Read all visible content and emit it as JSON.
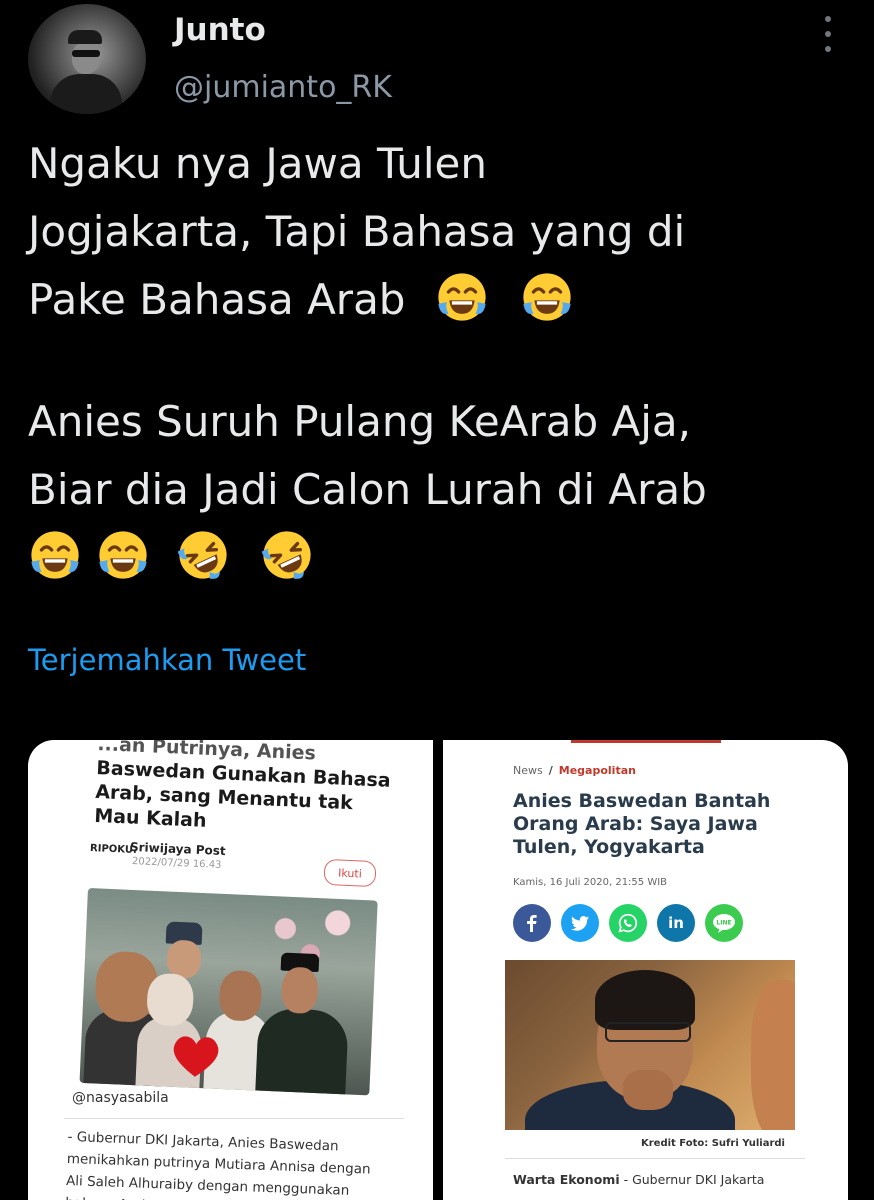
{
  "tweet": {
    "display_name": "Junto",
    "handle": "@jumianto_RK",
    "avatar_icon": "user-avatar",
    "more_icon": "more-options-icon",
    "text_lines": [
      "Ngaku nya Jawa Tulen",
      "Jogjakarta, Tapi Bahasa yang di",
      "Pake Bahasa Arab",
      "Anies Suruh Pulang KeArab Aja,",
      "Biar dia Jadi Calon Lurah di Arab"
    ],
    "emoji": {
      "tears_of_joy": "face-with-tears-of-joy",
      "rolling_laughing": "rolling-on-the-floor-laughing"
    },
    "translate_label": "Terjemahkan Tweet"
  },
  "media": {
    "left": {
      "title_top": "...an Putrinya, Anies",
      "title_lines": "Baswedan Gunakan Bahasa Arab, sang Menantu tak Mau Kalah",
      "source_logo": "RIPOKU.",
      "source": "Sriwijaya Post",
      "date": "2022/07/29 16.43",
      "follow_label": "Ikuti",
      "user": "@nasyasabila",
      "body": "- Gubernur DKI Jakarta, Anies Baswedan menikahkan putrinya Mutiara Annisa dengan Ali Saleh Alhuraiby dengan menggunakan bahasa Arab..."
    },
    "right": {
      "breadcrumb_home": "News",
      "breadcrumb_sep": "/",
      "breadcrumb_cat": "Megapolitan",
      "headline": "Anies Baswedan Bantah Orang Arab: Saya Jawa Tulen, Yogyakarta",
      "date": "Kamis, 16 Juli 2020, 21:55 WIB",
      "share": [
        {
          "icon": "facebook-icon",
          "glyph": "f",
          "color": "#3b5998"
        },
        {
          "icon": "twitter-icon",
          "glyph": "t",
          "color": "#1da1f2"
        },
        {
          "icon": "whatsapp-icon",
          "glyph": "w",
          "color": "#25d366"
        },
        {
          "icon": "linkedin-icon",
          "glyph": "in",
          "color": "#0e76a8"
        },
        {
          "icon": "line-icon",
          "glyph": "LINE",
          "color": "#3acb4f"
        }
      ],
      "caption": "Kredit Foto: Sufri Yuliardi",
      "lead_source": "Warta Ekonomi",
      "lead_text": " - Gubernur DKI Jakarta"
    }
  }
}
